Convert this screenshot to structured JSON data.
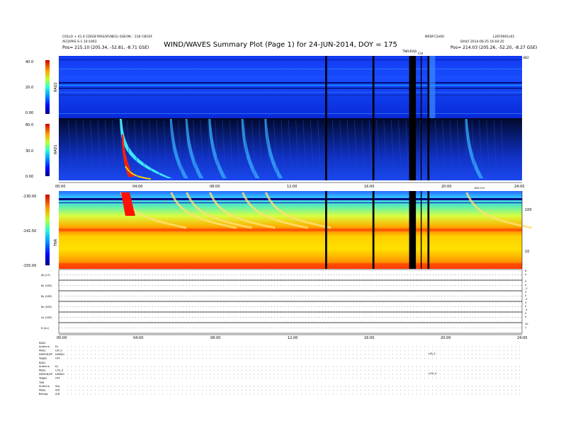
{
  "header": {
    "title": "WIND/WAVES Summary Plot (Page 1) for 24-JUN-2014, DOY = 175",
    "left_line1": "COLLO + 41.4 CDGSF/RAS/SF(NEG) GSE(M) : 118 CDGSF",
    "left_line2": "ACQ/PAS S-1 10:1063",
    "left_position": "Pos=  215.10 (205.34, -52.81, -8.71 GSE)",
    "right_code": "NRDFC2x00",
    "right_id": "L2EF0001s01",
    "right_line2": "DAILY 2014-06-25 16:04:25",
    "right_position": "Pos=  214.03 (205.26, -52.20, -8.27 GSE)",
    "marker_thermal": "TNR/RAD",
    "marker_cal": "Cal",
    "corner_label": "dB2"
  },
  "panels": {
    "rad2": {
      "label": "RAD2",
      "ticks": [
        "40.0",
        "20.0",
        "0.00"
      ]
    },
    "rad1": {
      "label": "RAD1",
      "ticks": [
        "60.0",
        "30.0",
        "0.00"
      ]
    },
    "tnr": {
      "label": "TNR",
      "ticks": [
        "-130.00",
        "-142.50",
        "-155.00"
      ],
      "right_ticks": [
        "100",
        "10"
      ],
      "tag": "RAV 0 N"
    }
  },
  "time_ticks": [
    "00:00",
    "04:00",
    "08:00",
    "12:00",
    "16:00",
    "20:00",
    "24:00"
  ],
  "mag_rows": [
    {
      "label": "|B| (nT)",
      "rt": [
        "6",
        "4"
      ]
    },
    {
      "label": "Bx (GSE)",
      "rt": [
        "3",
        "0",
        "-3"
      ]
    },
    {
      "label": "By (GSE)",
      "rt": [
        "3",
        "0",
        "-3"
      ]
    },
    {
      "label": "Bz (GSE)",
      "rt": [
        "3",
        "0",
        "-3"
      ]
    },
    {
      "label": "Vx (GSE)",
      "rt": [
        "4",
        "0"
      ]
    },
    {
      "label": "N (/cc)",
      "rt": [
        "10",
        "1"
      ]
    }
  ],
  "settings_groups": [
    {
      "name": "RAD2",
      "rows": [
        [
          "Antenna",
          "Ex"
        ],
        [
          "Mode",
          "LIN_S"
        ],
        [
          "DEMOD/SP",
          "DSMAG"
        ],
        [
          "Toggle",
          "OFF"
        ]
      ],
      "tag": "LIN_S"
    },
    {
      "name": "RAD1",
      "rows": [
        [
          "Antenna",
          "Ey"
        ],
        [
          "Mode",
          "LOG_S"
        ],
        [
          "DEMOD/SP",
          "DSMAG"
        ],
        [
          "Toggle",
          "OFF"
        ]
      ],
      "tag": "LOG_S"
    },
    {
      "name": "TNR",
      "rows": [
        [
          "Antenna",
          "Sdy"
        ],
        [
          "Mode",
          "A/D"
        ],
        [
          "Bemag",
          "A/D"
        ]
      ],
      "tag": ""
    }
  ],
  "chart_data": [
    {
      "type": "heatmap",
      "title": "RAD2",
      "ylabel": "RAD2",
      "ylim": [
        0,
        40
      ],
      "x_range_hours": [
        0,
        24
      ],
      "colorbar_ticks": [
        40.0,
        20.0,
        0.0
      ],
      "background_level": "low (blue)",
      "data_gaps_hours": [
        [
          13.8,
          13.9
        ],
        [
          16.25,
          16.35
        ],
        [
          18.15,
          18.5
        ],
        [
          18.75,
          18.8
        ],
        [
          19.1,
          19.2
        ]
      ]
    },
    {
      "type": "heatmap",
      "title": "RAD1",
      "ylabel": "RAD1",
      "ylim": [
        0,
        60
      ],
      "x_range_hours": [
        0,
        24
      ],
      "colorbar_ticks": [
        60.0,
        30.0,
        0.0
      ],
      "bursts_start_hours": [
        3.3,
        5.9,
        6.7,
        7.9,
        9.6,
        10.8,
        21.2
      ],
      "strongest_burst_hour": 3.3
    },
    {
      "type": "heatmap",
      "title": "TNR",
      "ylabel": "TNR",
      "ylim": [
        -155.0,
        -130.0
      ],
      "x_range_hours": [
        0,
        24
      ],
      "colorbar_ticks": [
        -130.0,
        -142.5,
        -155.0
      ],
      "right_axis_ticks": [
        100,
        10
      ]
    }
  ],
  "colors": {
    "jet_low": "#00007f",
    "jet_mid": "#1a4dff",
    "jet_high": "#ff2000",
    "gap": "#000000"
  }
}
